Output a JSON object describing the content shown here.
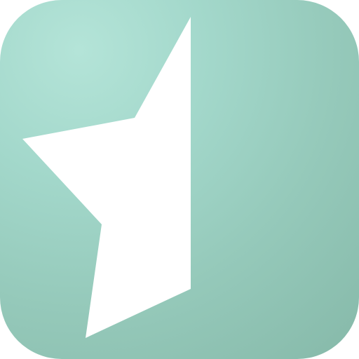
{
  "app_icon": {
    "icon_name": "half-star-icon",
    "colors": {
      "background_light": "#b4e4d8",
      "background_mid": "#95c9ba",
      "background_dark": "#86b9a9",
      "glyph": "#ffffff"
    }
  }
}
